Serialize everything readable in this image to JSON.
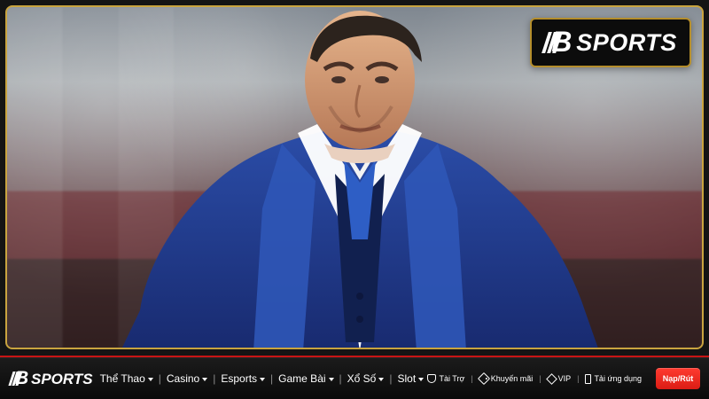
{
  "brand": {
    "text": "SPORTS"
  },
  "nav": {
    "brand_text": "SPORTS",
    "items": [
      {
        "label": "Thể Thao",
        "caret": true
      },
      {
        "label": "Casino",
        "caret": true
      },
      {
        "label": "Esports",
        "caret": true
      },
      {
        "label": "Game Bài",
        "caret": true
      },
      {
        "label": "Xổ Số",
        "caret": true
      },
      {
        "label": "Slot",
        "caret": true
      }
    ],
    "right_links": [
      {
        "label": "Tài Trợ",
        "icon": "shield-icon"
      },
      {
        "label": "Khuyến mãi",
        "icon": "tag-icon"
      },
      {
        "label": "VIP",
        "icon": "diamond-icon"
      },
      {
        "label": "Tải ứng dụng",
        "icon": "phone-icon"
      }
    ],
    "cta": "Nạp/Rút"
  },
  "colors": {
    "accent_red": "#db1c14",
    "gold": "#c9a43f"
  }
}
